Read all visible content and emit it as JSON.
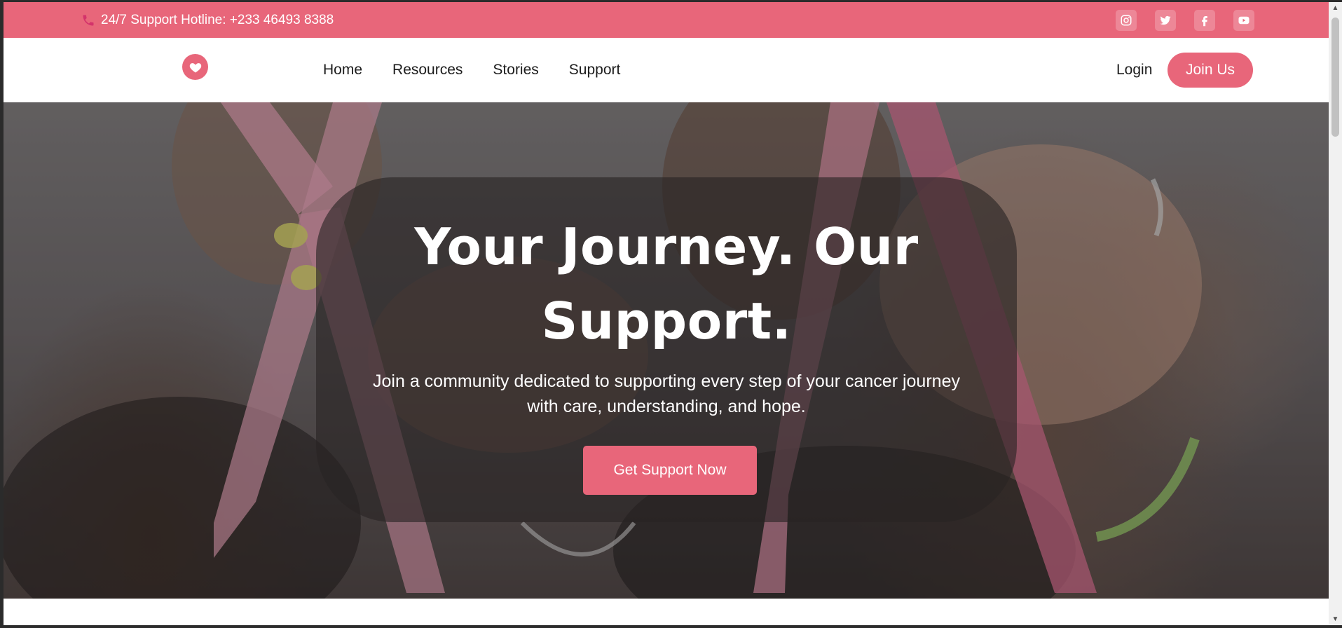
{
  "topbar": {
    "hotline": "24/7 Support Hotline: +233 46493 8388",
    "icons": [
      "phone-icon",
      "instagram-icon",
      "twitter-icon",
      "facebook-icon",
      "youtube-icon"
    ]
  },
  "nav": {
    "logo_icon": "heart-icon",
    "links": [
      "Home",
      "Resources",
      "Stories",
      "Support"
    ],
    "login": "Login",
    "join": "Join Us"
  },
  "hero": {
    "title": "Your Journey. Our Support.",
    "subtitle": "Join a community dedicated to supporting every step of your cancer journey with care, understanding, and hope.",
    "cta": "Get Support Now"
  },
  "colors": {
    "accent": "#e8667a",
    "nav_text": "#1c1c1c",
    "white": "#ffffff"
  }
}
